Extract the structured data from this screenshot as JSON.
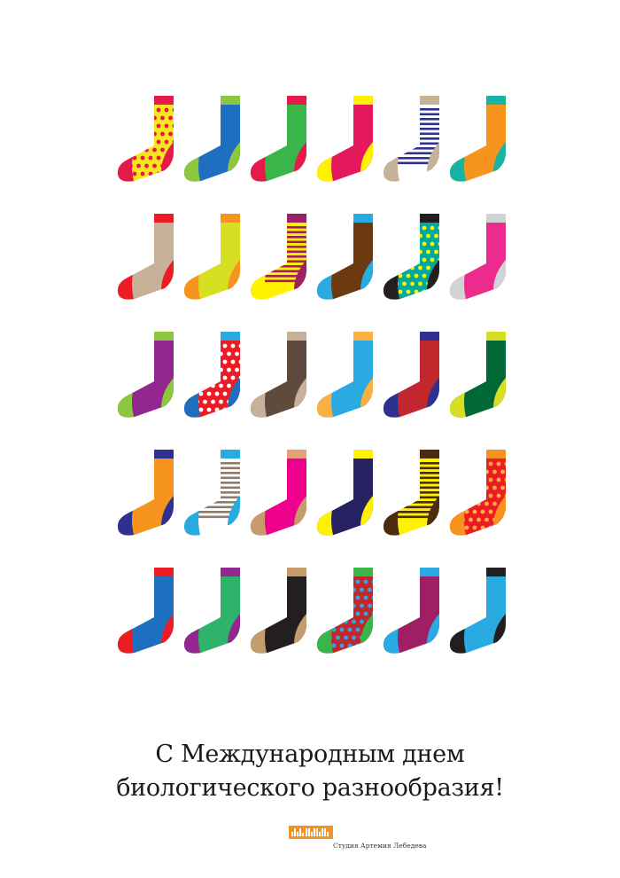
{
  "greeting": {
    "line1": "С Международным днем",
    "line2": "биологического разнообразия!"
  },
  "footer": {
    "studio": "Студия Артемия Лебедева",
    "logo_color": "#f39324"
  },
  "socks": [
    [
      {
        "body": "#f7e51d",
        "band": "#e6194b",
        "heel": "#e6194b",
        "toe": "#e6194b",
        "pattern": "dots",
        "pc": "#e6194b"
      },
      {
        "body": "#1f6fc1",
        "band": "#8dc63f",
        "heel": "#8dc63f",
        "toe": "#8dc63f"
      },
      {
        "body": "#39b54a",
        "band": "#e6194b",
        "heel": "#e6194b",
        "toe": "#e6194b"
      },
      {
        "body": "#e4185c",
        "band": "#fff200",
        "heel": "#fff200",
        "toe": "#fff200"
      },
      {
        "body": "#ffffff",
        "band": "#c7b299",
        "heel": "#c7b299",
        "toe": "#c7b299",
        "pattern": "stripes",
        "pc": "#2e3192"
      },
      {
        "body": "#f7941d",
        "band": "#17b3a5",
        "heel": "#17b3a5",
        "toe": "#17b3a5"
      }
    ],
    [
      {
        "body": "#c7b299",
        "band": "#ed1c24",
        "heel": "#ed1c24",
        "toe": "#ed1c24"
      },
      {
        "body": "#d7df23",
        "band": "#f7941d",
        "heel": "#f7941d",
        "toe": "#f7941d"
      },
      {
        "body": "#fff200",
        "band": "#9e1f63",
        "heel": "#9e1f63",
        "toe": "#fff200",
        "pattern": "stripes",
        "pc": "#9e1f63"
      },
      {
        "body": "#6b3a10",
        "band": "#29abe2",
        "heel": "#29abe2",
        "toe": "#29abe2"
      },
      {
        "body": "#00a99d",
        "band": "#231f20",
        "heel": "#231f20",
        "toe": "#231f20",
        "pattern": "dots",
        "pc": "#fff200"
      },
      {
        "body": "#ec2b8c",
        "band": "#d1d3d4",
        "heel": "#d1d3d4",
        "toe": "#d1d3d4"
      }
    ],
    [
      {
        "body": "#92278f",
        "band": "#8dc63f",
        "heel": "#8dc63f",
        "toe": "#8dc63f"
      },
      {
        "body": "#ed1c24",
        "band": "#29abe2",
        "heel": "#1f6fc1",
        "toe": "#1f6fc1",
        "pattern": "dots",
        "pc": "#ffffff"
      },
      {
        "body": "#5f4a3e",
        "band": "#c7b299",
        "heel": "#c7b299",
        "toe": "#c7b299"
      },
      {
        "body": "#29abe2",
        "band": "#fbb040",
        "heel": "#fbb040",
        "toe": "#fbb040"
      },
      {
        "body": "#c1272d",
        "band": "#2e3192",
        "heel": "#2e3192",
        "toe": "#2e3192"
      },
      {
        "body": "#006837",
        "band": "#d7df23",
        "heel": "#d7df23",
        "toe": "#d7df23"
      }
    ],
    [
      {
        "body": "#f7941d",
        "band": "#2e3192",
        "heel": "#2e3192",
        "toe": "#2e3192"
      },
      {
        "body": "#ffffff",
        "band": "#29abe2",
        "heel": "#29abe2",
        "toe": "#29abe2",
        "pattern": "stripes",
        "pc": "#8c7b6b"
      },
      {
        "body": "#ec008c",
        "band": "#e8a07a",
        "heel": "#c69c6d",
        "toe": "#c69c6d"
      },
      {
        "body": "#262262",
        "band": "#fff200",
        "heel": "#fff200",
        "toe": "#fff200"
      },
      {
        "body": "#fff200",
        "band": "#4a2c0e",
        "heel": "#4a2c0e",
        "toe": "#4a2c0e",
        "pattern": "stripes",
        "pc": "#4a2c0e"
      },
      {
        "body": "#ed1c24",
        "band": "#f7941d",
        "heel": "#f7941d",
        "toe": "#f7941d",
        "pattern": "dots",
        "pc": "#fbb040"
      }
    ],
    [
      {
        "body": "#1f6fc1",
        "band": "#ed1c24",
        "heel": "#ed1c24",
        "toe": "#ed1c24"
      },
      {
        "body": "#2fb36b",
        "band": "#92278f",
        "heel": "#92278f",
        "toe": "#92278f"
      },
      {
        "body": "#231f20",
        "band": "#c69c6d",
        "heel": "#c69c6d",
        "toe": "#c69c6d"
      },
      {
        "body": "#c1272d",
        "band": "#39b54a",
        "heel": "#39b54a",
        "toe": "#39b54a",
        "pattern": "dots",
        "pc": "#29abe2"
      },
      {
        "body": "#9e1f63",
        "band": "#29abe2",
        "heel": "#29abe2",
        "toe": "#29abe2"
      },
      {
        "body": "#29abe2",
        "band": "#231f20",
        "heel": "#231f20",
        "toe": "#231f20"
      }
    ]
  ]
}
